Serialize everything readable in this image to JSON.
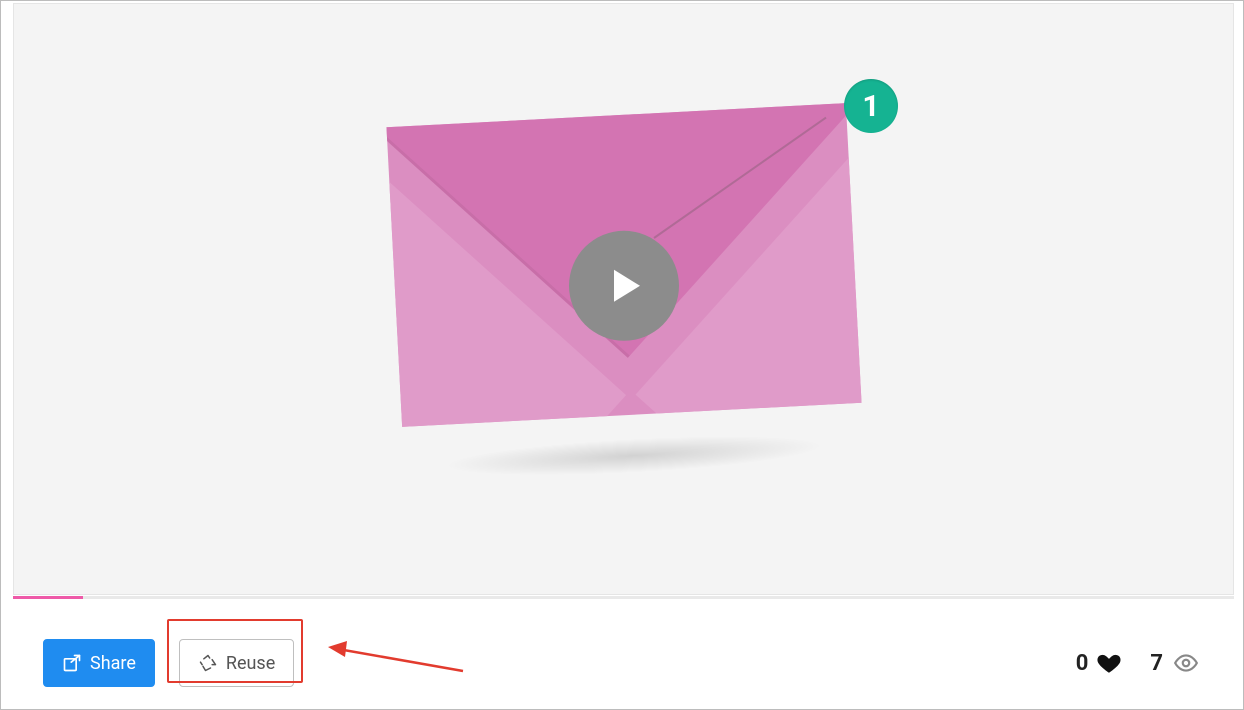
{
  "colors": {
    "accent_blue": "#1f8cf0",
    "badge_green": "#15b392",
    "envelope_pink": "#db8ec1",
    "highlight_red": "#e23b2e"
  },
  "annotation": {
    "badge_value": "1"
  },
  "actions": {
    "share_label": "Share",
    "reuse_label": "Reuse"
  },
  "stats": {
    "likes": "0",
    "views": "7"
  }
}
